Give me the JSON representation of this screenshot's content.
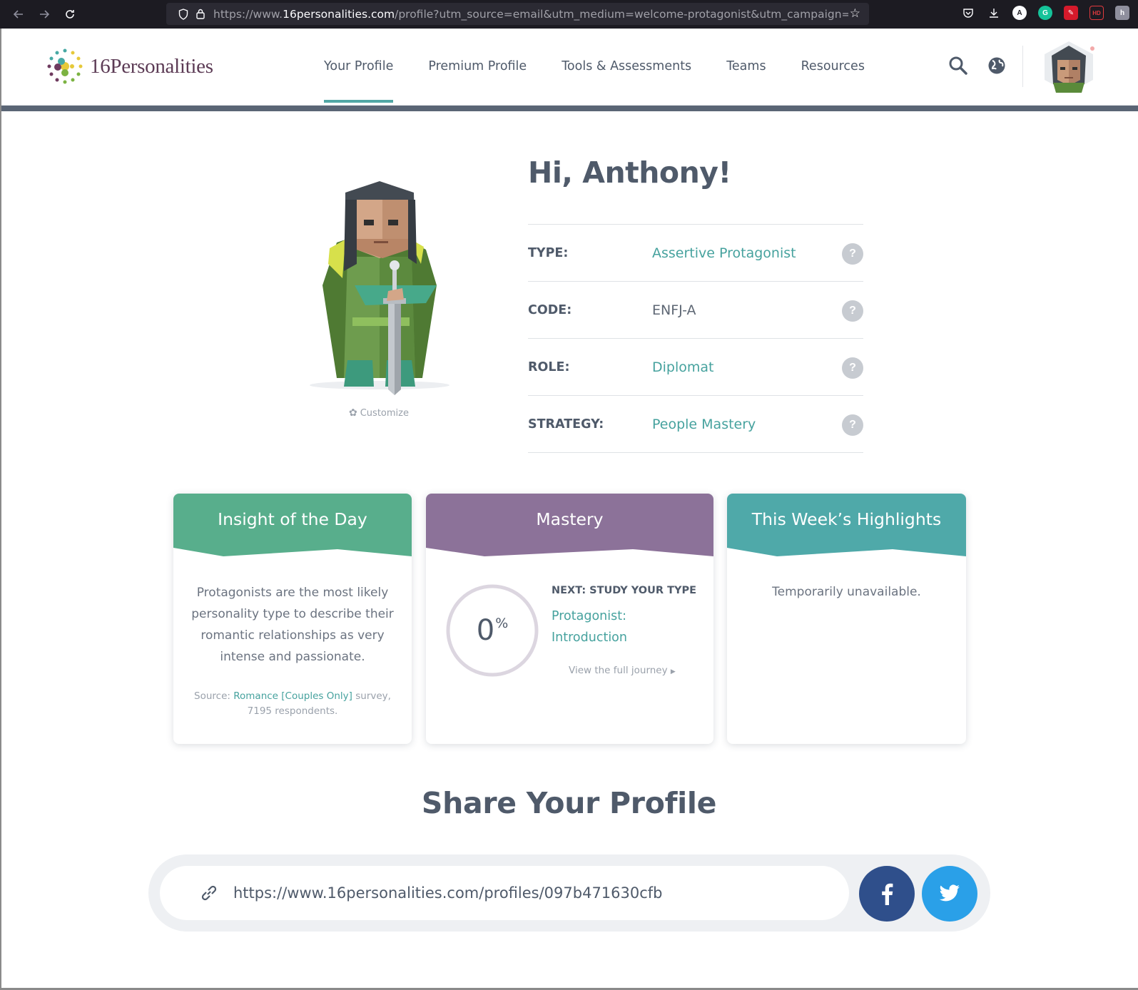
{
  "browser": {
    "url_prefix": "https://www.",
    "url_domain": "16personalities.com",
    "url_rest": "/profile?utm_source=email&utm_medium=welcome-protagonist&utm_campaign=p",
    "extensions": [
      "pocket-icon",
      "download-icon",
      "extension-a-icon",
      "grammarly-icon",
      "extension-red-icon",
      "hd-extension-icon",
      "extension-gray-icon"
    ]
  },
  "header": {
    "logo_text": "16Personalities",
    "nav": [
      {
        "label": "Your Profile",
        "active": true
      },
      {
        "label": "Premium Profile",
        "active": false
      },
      {
        "label": "Tools & Assessments",
        "active": false
      },
      {
        "label": "Teams",
        "active": false
      },
      {
        "label": "Resources",
        "active": false
      }
    ]
  },
  "profile": {
    "greeting": "Hi, Anthony!",
    "customize_label": "Customize",
    "rows": [
      {
        "label": "TYPE:",
        "value": "Assertive Protagonist",
        "link": true
      },
      {
        "label": "CODE:",
        "value": "ENFJ-A",
        "link": false
      },
      {
        "label": "ROLE:",
        "value": "Diplomat",
        "link": true
      },
      {
        "label": "STRATEGY:",
        "value": "People Mastery",
        "link": true
      }
    ],
    "help_glyph": "?"
  },
  "cards": {
    "insight": {
      "title": "Insight of the Day",
      "text": "Protagonists are the most likely personality type to describe their romantic relationships as very intense and passionate.",
      "source_prefix": "Source: ",
      "source_link": "Romance [Couples Only]",
      "source_suffix": " survey,",
      "respondents": "7195 respondents.",
      "color": "#58ae8c"
    },
    "mastery": {
      "title": "Mastery",
      "percent": "0",
      "percent_sign": "%",
      "progress": 0,
      "next_label": "NEXT: STUDY YOUR TYPE",
      "link_line1": "Protagonist:",
      "link_line2": "Introduction",
      "journey_label": "View the full journey",
      "color": "#8c7299"
    },
    "highlights": {
      "title": "This Week’s Highlights",
      "text": "Temporarily unavailable.",
      "color": "#4fa9a9"
    }
  },
  "share": {
    "title": "Share Your Profile",
    "url": "https://www.16personalities.com/profiles/097b471630cfb",
    "facebook_color": "#2f4f8b",
    "twitter_color": "#2aa0e8"
  }
}
